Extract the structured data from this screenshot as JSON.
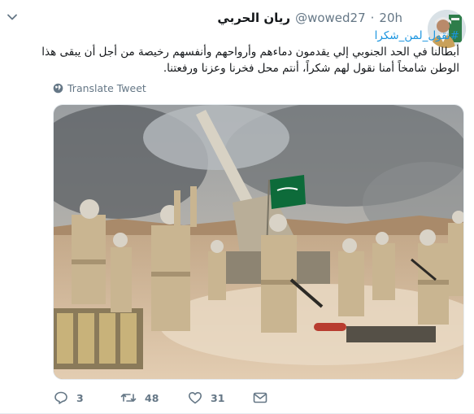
{
  "tweet": {
    "display_name": "ريان الحربي",
    "handle": "@wowed27",
    "separator": "·",
    "time": "20h",
    "hashtag": "#تقول_لمن_شكرا",
    "text": "أبطالنا  في الحد الجنوبي إلي يقدمون دماءهم وأرواحهم وأنفسهم رخيصة من أجل أن يبقى هذا الوطن شامخاً أمنا نقول لهم شكراً، أنتم محل فخرنا وعزنا ورفعتنا.",
    "translate_label": "Translate Tweet"
  },
  "actions": {
    "replies": "3",
    "retweets": "48",
    "likes": "31"
  },
  "colors": {
    "link": "#1b95e0",
    "secondary": "#657786",
    "flag_green": "#0d6b3a"
  },
  "icons": {
    "menu": "chevron-down-icon",
    "translate": "globe-icon",
    "reply": "reply-icon",
    "retweet": "retweet-icon",
    "like": "heart-icon",
    "message": "envelope-icon"
  }
}
